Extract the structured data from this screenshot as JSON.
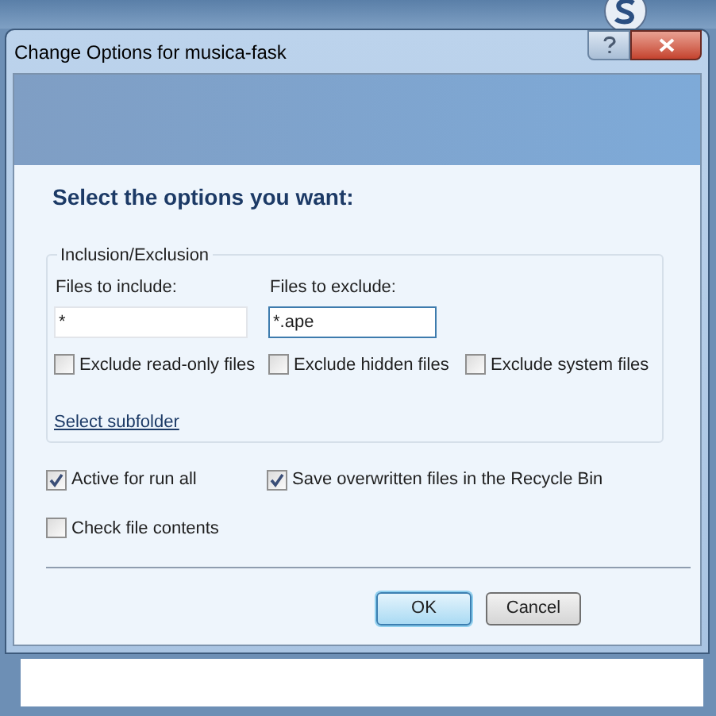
{
  "window": {
    "title": "Change Options for musica-fask"
  },
  "heading": "Select the options you want:",
  "group": {
    "title": "Inclusion/Exclusion",
    "fields": [
      {
        "label": "Files to include:",
        "value": "*",
        "focused": false
      },
      {
        "label": "Files to exclude:",
        "value": "*.ape",
        "focused": true
      }
    ],
    "checkboxes": [
      {
        "label": "Exclude read-only files",
        "checked": false
      },
      {
        "label": "Exclude hidden files",
        "checked": false
      },
      {
        "label": "Exclude system files",
        "checked": false
      }
    ],
    "link": "Select subfolder"
  },
  "options": [
    {
      "label": "Active for run all",
      "checked": true
    },
    {
      "label": "Save overwritten files in the Recycle Bin",
      "checked": true
    },
    {
      "label": "Check file contents",
      "checked": false
    }
  ],
  "buttons": [
    {
      "label": "OK",
      "default": true
    },
    {
      "label": "Cancel",
      "default": false
    }
  ]
}
